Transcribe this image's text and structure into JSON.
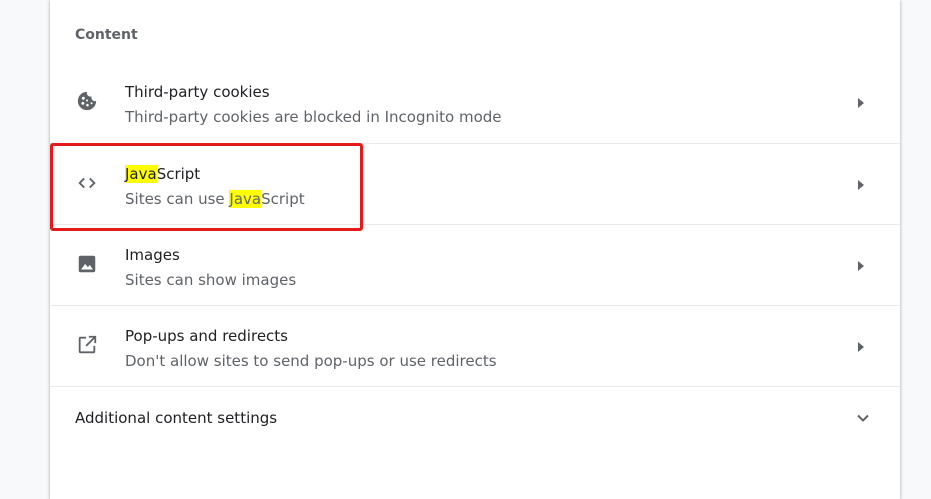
{
  "content": {
    "section_title": "Content",
    "items": [
      {
        "title": "Third-party cookies",
        "subtitle": "Third-party cookies are blocked in Incognito mode",
        "icon": "cookie-icon"
      },
      {
        "title_hl": "Java",
        "title_rest": "Script",
        "subtitle_pre": "Sites can use ",
        "subtitle_hl": "Java",
        "subtitle_rest": "Script",
        "icon": "code-icon"
      },
      {
        "title": "Images",
        "subtitle": "Sites can show images",
        "icon": "image-icon"
      },
      {
        "title": "Pop-ups and redirects",
        "subtitle": "Don't allow sites to send pop-ups or use redirects",
        "icon": "open-in-new-icon"
      }
    ],
    "additional_label": "Additional content settings"
  },
  "colors": {
    "highlight_box": "#e31b1b",
    "search_highlight": "#ffff00",
    "icon": "#5f6368"
  }
}
